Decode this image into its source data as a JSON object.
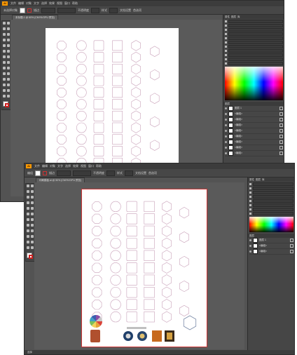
{
  "window_1": {
    "menu": [
      "文件",
      "编辑",
      "对象",
      "文字",
      "选择",
      "效果",
      "视图",
      "窗口",
      "帮助"
    ],
    "control_bar": {
      "selection": "未选择对象",
      "stroke": "描边",
      "opacity": "不透明度",
      "style": "样式",
      "doc_setup": "文档设置",
      "preferences": "首选项"
    },
    "doc_tab": "未标题-1 @ 60% (CMYK/GPU 预览)",
    "panels": {
      "tabs": [
        "属性",
        "图层",
        "库"
      ],
      "layers_tab": "图层",
      "layer_rows": [
        "图层 1",
        "<编组>",
        "<编组>",
        "<编组>",
        "<编组>",
        "<编组>",
        "<编组>",
        "<编组>",
        "<编组>"
      ]
    }
  },
  "window_2": {
    "menu": [
      "文件",
      "编辑",
      "对象",
      "文字",
      "选择",
      "效果",
      "视图",
      "窗口",
      "帮助"
    ],
    "control_bar": {
      "selection": "编组",
      "stroke": "描边",
      "opacity": "不透明度",
      "style": "样式",
      "doc_setup": "文档设置",
      "preferences": "首选项"
    },
    "doc_tab": "印刷模板.ai @ 50% (CMYK/GPU 预览)",
    "panels": {
      "tabs": [
        "属性",
        "图层",
        "库"
      ],
      "layers_tab": "图层",
      "layer_rows": [
        "图层 1",
        "<编组>",
        "<编组>"
      ]
    },
    "status": "选择"
  },
  "colors": {
    "accent": "#ff9a00",
    "artboard_border": "#cc3333",
    "shape_stroke": "#c8a0b8"
  },
  "icons": [
    "ai-logo-icon",
    "selection-tool-icon",
    "pen-tool-icon",
    "type-tool-icon",
    "eye-icon",
    "fill-swatch-icon",
    "stroke-swatch-icon",
    "color-spectrum-icon"
  ]
}
